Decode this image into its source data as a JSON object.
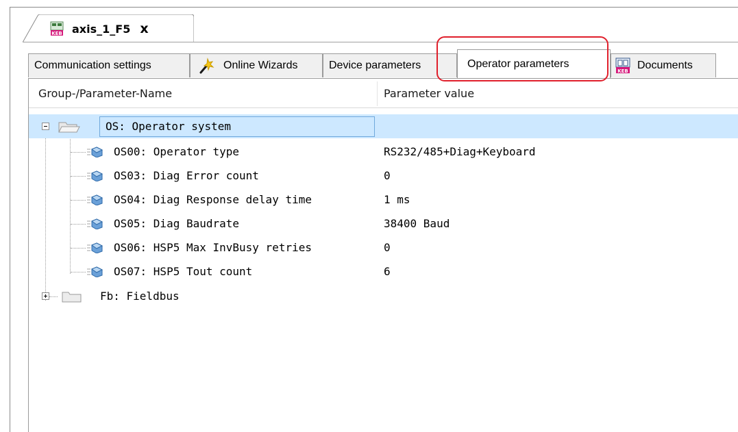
{
  "document_tab": {
    "title": "axis_1_F5",
    "close_label": "x",
    "icon": "keb-device-icon"
  },
  "param_tabs": [
    {
      "label": "Communication settings",
      "icon": null
    },
    {
      "label": "Online Wizards",
      "icon": "wizard-wand-icon"
    },
    {
      "label": "Device parameters",
      "icon": null
    },
    {
      "label": "Operator parameters",
      "icon": null,
      "active": true
    },
    {
      "label": "Documents",
      "icon": "keb-documents-icon"
    }
  ],
  "grid": {
    "col_name": "Group-/Parameter-Name",
    "col_value": "Parameter value",
    "group_os": {
      "name": "OS: Operator system",
      "expanded": true,
      "selected": true
    },
    "params": [
      {
        "name": "OS00: Operator type",
        "value": "RS232/485+Diag+Keyboard"
      },
      {
        "name": "OS03: Diag Error count",
        "value": "0"
      },
      {
        "name": "OS04: Diag Response delay time",
        "value": "1 ms"
      },
      {
        "name": "OS05: Diag Baudrate",
        "value": "38400 Baud"
      },
      {
        "name": "OS06: HSP5 Max InvBusy retries",
        "value": "0"
      },
      {
        "name": "OS07: HSP5 Tout count",
        "value": "6"
      }
    ],
    "group_fb": {
      "name": "Fb: Fieldbus",
      "expanded": false
    }
  },
  "colors": {
    "selection": "#cde8ff",
    "highlight_ring": "#e01e2a",
    "tab_bg": "#f0f0f0"
  }
}
